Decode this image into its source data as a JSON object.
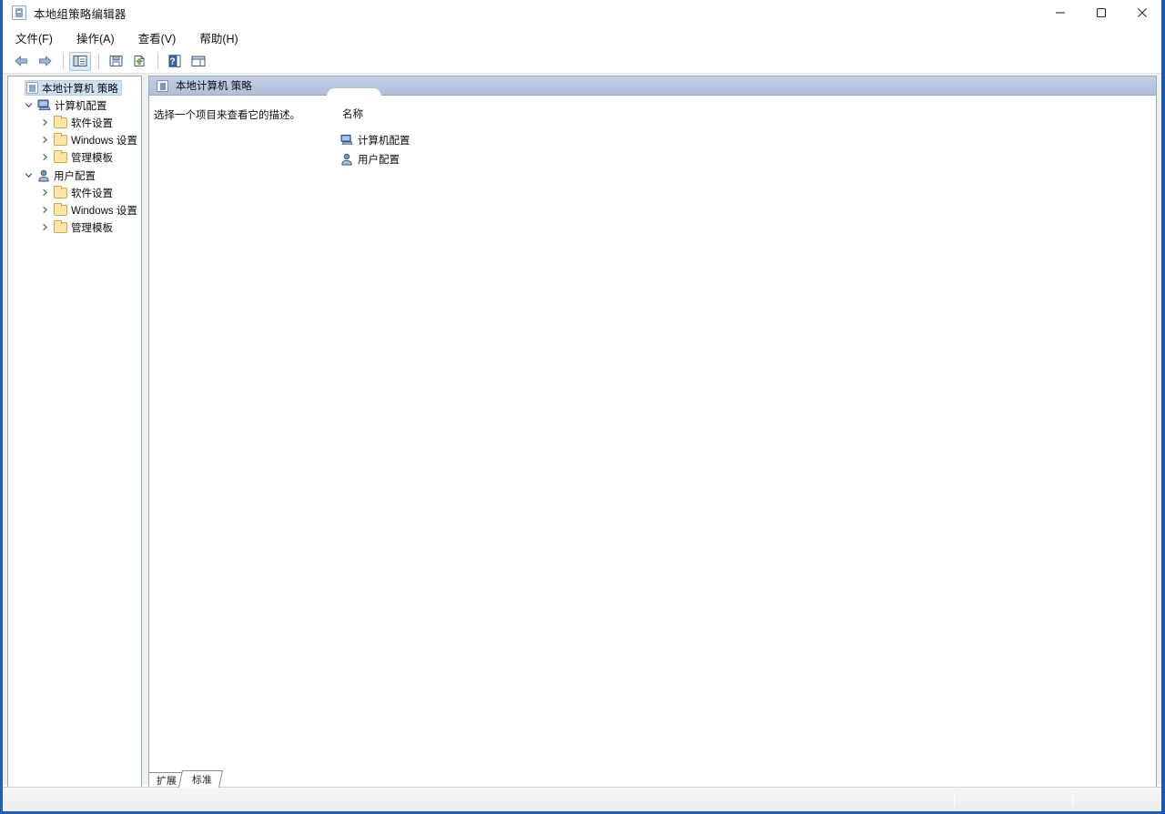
{
  "window": {
    "title": "本地组策略编辑器",
    "title_icon": "mmc-console-icon",
    "controls": {
      "minimize": "最小化",
      "maximize": "最大化",
      "close": "关闭"
    }
  },
  "menubar": {
    "items": [
      {
        "label": "文件(F)",
        "name": "menu-file"
      },
      {
        "label": "操作(A)",
        "name": "menu-action"
      },
      {
        "label": "查看(V)",
        "name": "menu-view"
      },
      {
        "label": "帮助(H)",
        "name": "menu-help"
      }
    ]
  },
  "toolbar": {
    "buttons": [
      {
        "name": "back-button",
        "icon": "arrow-left-icon",
        "pressed": false
      },
      {
        "name": "forward-button",
        "icon": "arrow-right-icon",
        "pressed": false
      },
      {
        "name": "show-hide-tree-button",
        "icon": "tree-pane-icon",
        "pressed": true
      },
      {
        "name": "save-button",
        "icon": "save-icon",
        "pressed": false
      },
      {
        "name": "export-list-button",
        "icon": "export-icon",
        "pressed": false
      },
      {
        "name": "help-button",
        "icon": "question-mark-icon",
        "pressed": false
      },
      {
        "name": "show-action-pane-button",
        "icon": "action-pane-icon",
        "pressed": false
      }
    ]
  },
  "tree": {
    "root": {
      "label": "本地计算机 策略",
      "icon": "policy-console-icon",
      "selected": true
    },
    "nodes": [
      {
        "label": "计算机配置",
        "icon": "computer-icon",
        "expanded": true,
        "children": [
          {
            "label": "软件设置",
            "icon": "folder-icon"
          },
          {
            "label": "Windows 设置",
            "icon": "folder-icon"
          },
          {
            "label": "管理模板",
            "icon": "folder-icon"
          }
        ]
      },
      {
        "label": "用户配置",
        "icon": "user-icon",
        "expanded": true,
        "children": [
          {
            "label": "软件设置",
            "icon": "folder-icon"
          },
          {
            "label": "Windows 设置",
            "icon": "folder-icon"
          },
          {
            "label": "管理模板",
            "icon": "folder-icon"
          }
        ]
      }
    ]
  },
  "right_pane": {
    "header_title": "本地计算机 策略",
    "header_icon": "policy-console-icon",
    "description": "选择一个项目来查看它的描述。",
    "column_header": "名称",
    "items": [
      {
        "label": "计算机配置",
        "icon": "computer-icon"
      },
      {
        "label": "用户配置",
        "icon": "user-icon"
      }
    ],
    "tabs": [
      {
        "label": "扩展",
        "active": false
      },
      {
        "label": "标准",
        "active": true
      }
    ]
  },
  "colors": {
    "window_border": "#1f5fb8",
    "pane_header": "#b8c4dc",
    "selection": "#cfe0f3",
    "folder": "#fde5a8",
    "computer_icon": "#3a63a8",
    "user_icon": "#4a6fb5"
  }
}
